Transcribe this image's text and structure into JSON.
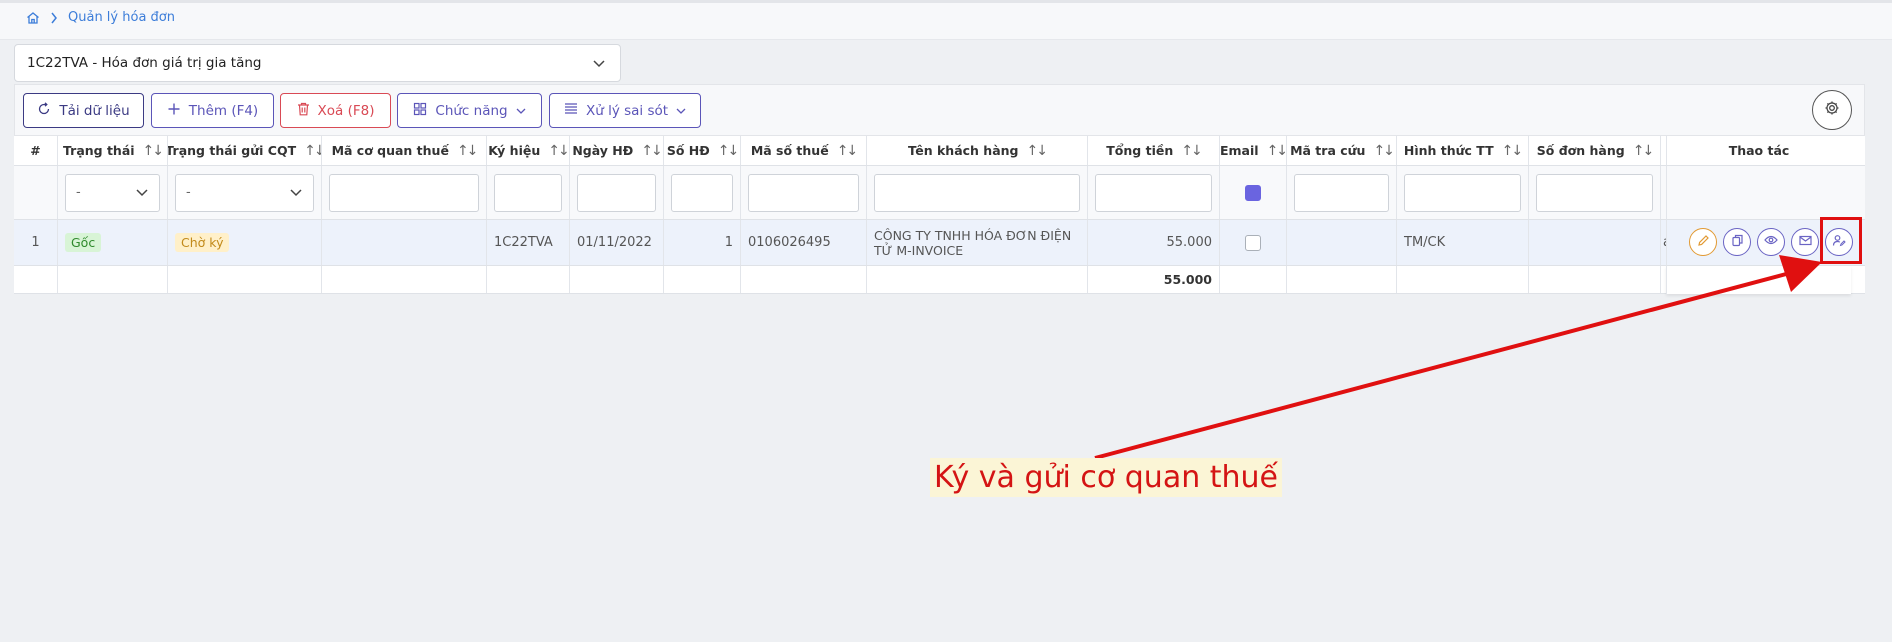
{
  "breadcrumb": {
    "label": "Quản lý hóa đơn"
  },
  "invoice_type_select": {
    "value": "1C22TVA - Hóa đơn giá trị gia tăng"
  },
  "toolbar": {
    "reload": "Tải dữ liệu",
    "add": "Thêm (F4)",
    "delete": "Xoá (F8)",
    "functions": "Chức năng",
    "handle_errors": "Xử lý sai sót"
  },
  "table": {
    "headers": {
      "index": "#",
      "status": "Trạng thái",
      "cqt_status": "Trạng thái gửi CQT",
      "tax_office_code": "Mã cơ quan thuế",
      "symbol": "Ký hiệu",
      "date": "Ngày HĐ",
      "number": "Số HĐ",
      "tax_code": "Mã số thuế",
      "customer": "Tên khách hàng",
      "total": "Tổng tiền",
      "email": "Email",
      "lookup": "Mã tra cứu",
      "payment": "Hình thức TT",
      "order_no": "Số đơn hàng",
      "actions": "Thao tác"
    },
    "filters": {
      "status": "-",
      "cqt_status": "-"
    },
    "rows": [
      {
        "index": "1",
        "status": "Gốc",
        "cqt_status": "Chờ ký",
        "tax_office_code": "",
        "symbol": "1C22TVA",
        "date": "01/11/2022",
        "number": "1",
        "tax_code": "0106026495",
        "customer": "CÔNG TY TNHH HÓA ĐƠN ĐIỆN TỬ M-INVOICE",
        "total": "55.000",
        "lookup": "",
        "payment": "TM/CK",
        "order_no": "",
        "extra": "ac"
      }
    ],
    "totals": {
      "total": "55.000"
    }
  },
  "annotation": {
    "text": "Ký và gửi cơ quan thuế"
  },
  "colors": {
    "primary": "#5b55b8",
    "danger": "#d94a55",
    "annotation": "#e01010"
  }
}
